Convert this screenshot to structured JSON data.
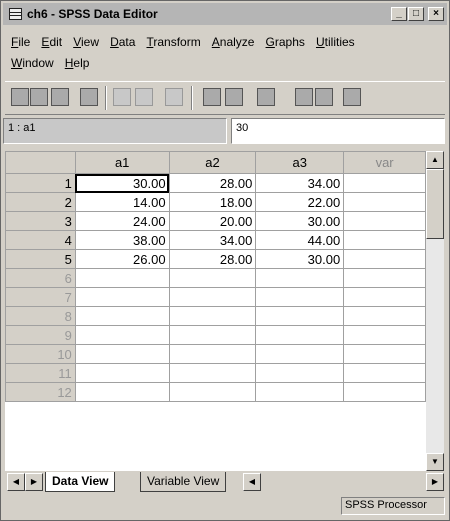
{
  "window": {
    "title": "ch6 - SPSS Data Editor"
  },
  "menu": [
    "File",
    "Edit",
    "View",
    "Data",
    "Transform",
    "Analyze",
    "Graphs",
    "Utilities"
  ],
  "menu2": [
    "Window",
    "Help"
  ],
  "toolbar_icons": [
    "open-icon",
    "save-icon",
    "print-icon",
    "dialog-recall-icon",
    "undo-icon",
    "redo-icon",
    "goto-chart-icon",
    "goto-case-icon",
    "variables-icon",
    "find-icon",
    "insert-case-icon",
    "insert-variable-icon",
    "split-file-icon"
  ],
  "cell_editor": {
    "ref": "1 : a1",
    "value": "30"
  },
  "grid": {
    "columns": [
      "a1",
      "a2",
      "a3",
      "var"
    ],
    "rows": [
      {
        "n": "1",
        "v": [
          "30.00",
          "28.00",
          "34.00",
          ""
        ]
      },
      {
        "n": "2",
        "v": [
          "14.00",
          "18.00",
          "22.00",
          ""
        ]
      },
      {
        "n": "3",
        "v": [
          "24.00",
          "20.00",
          "30.00",
          ""
        ]
      },
      {
        "n": "4",
        "v": [
          "38.00",
          "34.00",
          "44.00",
          ""
        ]
      },
      {
        "n": "5",
        "v": [
          "26.00",
          "28.00",
          "30.00",
          ""
        ]
      },
      {
        "n": "6",
        "v": [
          "",
          "",
          "",
          ""
        ]
      },
      {
        "n": "7",
        "v": [
          "",
          "",
          "",
          ""
        ]
      },
      {
        "n": "8",
        "v": [
          "",
          "",
          "",
          ""
        ]
      },
      {
        "n": "9",
        "v": [
          "",
          "",
          "",
          ""
        ]
      },
      {
        "n": "10",
        "v": [
          "",
          "",
          "",
          ""
        ]
      },
      {
        "n": "11",
        "v": [
          "",
          "",
          "",
          ""
        ]
      },
      {
        "n": "12",
        "v": [
          "",
          "",
          "",
          ""
        ]
      }
    ]
  },
  "tabs": {
    "data_view": "Data View",
    "variable_view": "Variable View"
  },
  "status": {
    "text": "SPSS Processor"
  }
}
